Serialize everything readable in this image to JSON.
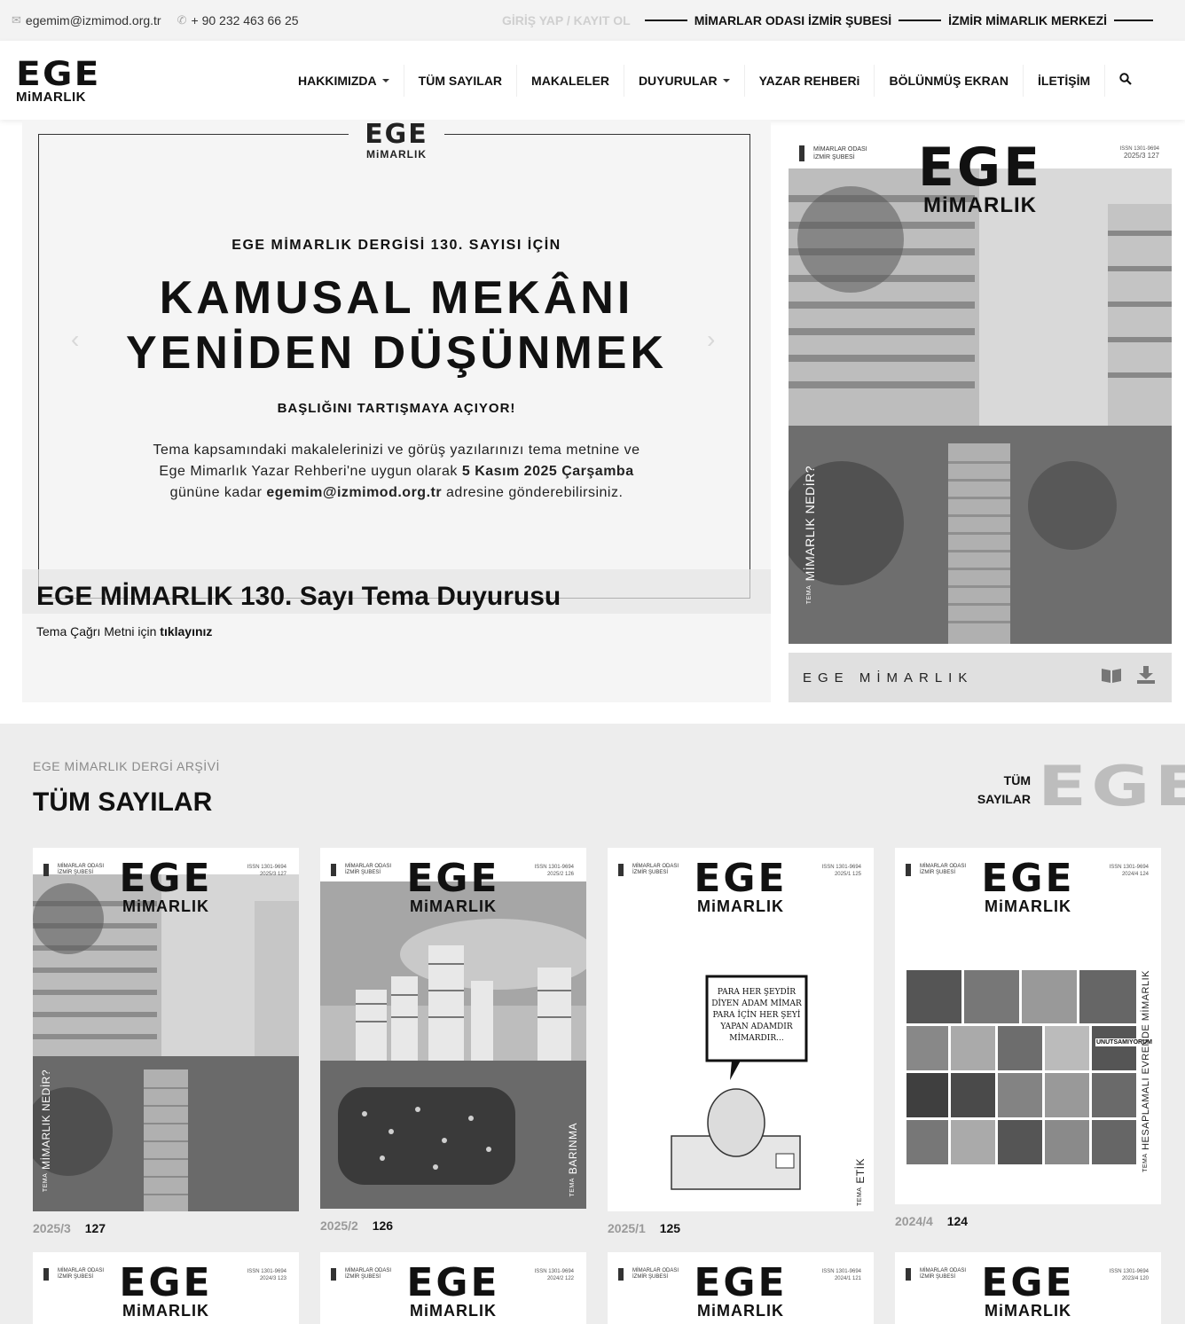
{
  "topbar": {
    "email": "egemim@izmimod.org.tr",
    "phone": "+ 90 232 463 66 25",
    "login": "GİRİŞ YAP / KAYIT OL",
    "links": [
      "MİMARLAR ODASI İZMİR ŞUBESİ",
      "İZMİR MİMARLIK MERKEZİ"
    ]
  },
  "logo": {
    "top": "EGE",
    "bottom": "MiMARLIK"
  },
  "nav": {
    "items": [
      "HAKKIMIZDA",
      "TÜM SAYILAR",
      "MAKALELER",
      "DUYURULAR",
      "YAZAR REHBERi",
      "BÖLÜNMÜŞ EKRAN",
      "İLETİŞİM"
    ],
    "search_icon": "search-icon"
  },
  "hero": {
    "frame_logo_top": "EGE",
    "frame_logo_bottom": "MiMARLIK",
    "pre": "EGE MİMARLIK DERGİSİ 130. SAYISI İÇİN",
    "headline_1": "KAMUSAL MEKÂNI",
    "headline_2": "YENİDEN DÜŞÜNMEK",
    "sub": "BAŞLIĞINI TARTIŞMAYA AÇIYOR!",
    "body_1": "Tema kapsamındaki makalelerinizi ve görüş yazılarınızı tema metnine ve",
    "body_2a": "Ege Mimarlık Yazar Rehberi'ne uygun olarak ",
    "body_2b": "5 Kasım 2025 Çarşamba",
    "body_3a": "gününe kadar ",
    "body_3b": "egemim@izmimod.org.tr",
    "body_3c": " adresine gönderebilirsiniz.",
    "caption_title": "EGE MİMARLIK 130. Sayı Tema Duyurusu",
    "caption_sub_a": "Tema Çağrı Metni için ",
    "caption_sub_b": "tıklayınız"
  },
  "side_issue": {
    "org": "MİMARLAR ODASI\nİZMİR ŞUBESİ",
    "issn": "ISSN 1301-9694",
    "issue": "2025/3 127",
    "theme_label": "TEMA",
    "theme": "MİMARLIK NEDİR?",
    "bar_name": "EGE MİMARLIK",
    "read_icon": "book-icon",
    "download_icon": "download-icon"
  },
  "archive": {
    "kicker": "EGE MİMARLIK DERGİ ARŞİVİ",
    "title": "TÜM SAYILAR",
    "all_link_1": "TÜM",
    "all_link_2": "SAYILAR",
    "watermark": "EGE",
    "cards": [
      {
        "date": "2025/3",
        "num": "127",
        "issn": "ISSN 1301-9694",
        "cover_issue": "2025/3 127",
        "theme": "MİMARLIK NEDİR?"
      },
      {
        "date": "2025/2",
        "num": "126",
        "issn": "ISSN 1301-9694",
        "cover_issue": "2025/2 126",
        "theme": "BARINMA"
      },
      {
        "date": "2025/1",
        "num": "125",
        "issn": "ISSN 1301-9694",
        "cover_issue": "2025/1 125",
        "theme": "ETİK"
      },
      {
        "date": "2024/4",
        "num": "124",
        "issn": "ISSN 1301-9694",
        "cover_issue": "2024/4 124",
        "theme": "HESAPLAMALI EVRENDE MİMARLIK"
      }
    ],
    "cards_row2": [
      {
        "cover_issue": "2024/3 123",
        "issn": "ISSN 1301-9694"
      },
      {
        "cover_issue": "2024/2 122",
        "issn": "ISSN 1301-9694"
      },
      {
        "cover_issue": "2024/1 121",
        "issn": "ISSN 1301-9694"
      },
      {
        "cover_issue": "2023/4 120",
        "issn": "ISSN 1301-9694"
      }
    ],
    "cover_org": "MİMARLAR ODASI\nİZMİR ŞUBESİ",
    "cover_logo_top": "EGE",
    "cover_logo_bottom": "MiMARLIK",
    "cover_theme_label": "TEMA",
    "speech_bubble": "PARA HER ŞEYDİR DİYEN ADAM MİMAR PARA İÇİN HER ŞEYİ YAPAN ADAMDIR MİMARDIR...",
    "cover124_banner": "UNUTSAMIYORUM"
  }
}
